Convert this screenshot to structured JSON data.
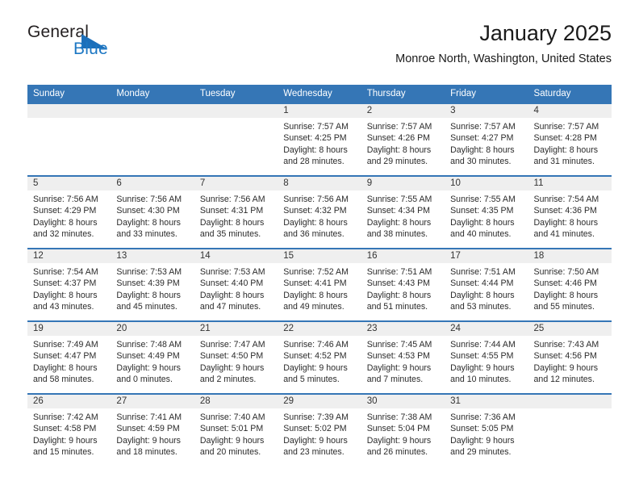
{
  "brand": {
    "name_top": "General",
    "name_bottom": "Blue",
    "triangle_icon": "triangle-icon",
    "accent_color": "#1c6fba"
  },
  "header": {
    "title": "January 2025",
    "subtitle": "Monroe North, Washington, United States"
  },
  "theme": {
    "header_blue": "#3576b6",
    "daynum_gray": "#efefef",
    "text": "#222222"
  },
  "weekday_headers": [
    "Sunday",
    "Monday",
    "Tuesday",
    "Wednesday",
    "Thursday",
    "Friday",
    "Saturday"
  ],
  "weeks": [
    [
      {
        "day": "",
        "sunrise": "",
        "sunset": "",
        "daylight_1": "",
        "daylight_2": ""
      },
      {
        "day": "",
        "sunrise": "",
        "sunset": "",
        "daylight_1": "",
        "daylight_2": ""
      },
      {
        "day": "",
        "sunrise": "",
        "sunset": "",
        "daylight_1": "",
        "daylight_2": ""
      },
      {
        "day": "1",
        "sunrise": "Sunrise: 7:57 AM",
        "sunset": "Sunset: 4:25 PM",
        "daylight_1": "Daylight: 8 hours",
        "daylight_2": "and 28 minutes."
      },
      {
        "day": "2",
        "sunrise": "Sunrise: 7:57 AM",
        "sunset": "Sunset: 4:26 PM",
        "daylight_1": "Daylight: 8 hours",
        "daylight_2": "and 29 minutes."
      },
      {
        "day": "3",
        "sunrise": "Sunrise: 7:57 AM",
        "sunset": "Sunset: 4:27 PM",
        "daylight_1": "Daylight: 8 hours",
        "daylight_2": "and 30 minutes."
      },
      {
        "day": "4",
        "sunrise": "Sunrise: 7:57 AM",
        "sunset": "Sunset: 4:28 PM",
        "daylight_1": "Daylight: 8 hours",
        "daylight_2": "and 31 minutes."
      }
    ],
    [
      {
        "day": "5",
        "sunrise": "Sunrise: 7:56 AM",
        "sunset": "Sunset: 4:29 PM",
        "daylight_1": "Daylight: 8 hours",
        "daylight_2": "and 32 minutes."
      },
      {
        "day": "6",
        "sunrise": "Sunrise: 7:56 AM",
        "sunset": "Sunset: 4:30 PM",
        "daylight_1": "Daylight: 8 hours",
        "daylight_2": "and 33 minutes."
      },
      {
        "day": "7",
        "sunrise": "Sunrise: 7:56 AM",
        "sunset": "Sunset: 4:31 PM",
        "daylight_1": "Daylight: 8 hours",
        "daylight_2": "and 35 minutes."
      },
      {
        "day": "8",
        "sunrise": "Sunrise: 7:56 AM",
        "sunset": "Sunset: 4:32 PM",
        "daylight_1": "Daylight: 8 hours",
        "daylight_2": "and 36 minutes."
      },
      {
        "day": "9",
        "sunrise": "Sunrise: 7:55 AM",
        "sunset": "Sunset: 4:34 PM",
        "daylight_1": "Daylight: 8 hours",
        "daylight_2": "and 38 minutes."
      },
      {
        "day": "10",
        "sunrise": "Sunrise: 7:55 AM",
        "sunset": "Sunset: 4:35 PM",
        "daylight_1": "Daylight: 8 hours",
        "daylight_2": "and 40 minutes."
      },
      {
        "day": "11",
        "sunrise": "Sunrise: 7:54 AM",
        "sunset": "Sunset: 4:36 PM",
        "daylight_1": "Daylight: 8 hours",
        "daylight_2": "and 41 minutes."
      }
    ],
    [
      {
        "day": "12",
        "sunrise": "Sunrise: 7:54 AM",
        "sunset": "Sunset: 4:37 PM",
        "daylight_1": "Daylight: 8 hours",
        "daylight_2": "and 43 minutes."
      },
      {
        "day": "13",
        "sunrise": "Sunrise: 7:53 AM",
        "sunset": "Sunset: 4:39 PM",
        "daylight_1": "Daylight: 8 hours",
        "daylight_2": "and 45 minutes."
      },
      {
        "day": "14",
        "sunrise": "Sunrise: 7:53 AM",
        "sunset": "Sunset: 4:40 PM",
        "daylight_1": "Daylight: 8 hours",
        "daylight_2": "and 47 minutes."
      },
      {
        "day": "15",
        "sunrise": "Sunrise: 7:52 AM",
        "sunset": "Sunset: 4:41 PM",
        "daylight_1": "Daylight: 8 hours",
        "daylight_2": "and 49 minutes."
      },
      {
        "day": "16",
        "sunrise": "Sunrise: 7:51 AM",
        "sunset": "Sunset: 4:43 PM",
        "daylight_1": "Daylight: 8 hours",
        "daylight_2": "and 51 minutes."
      },
      {
        "day": "17",
        "sunrise": "Sunrise: 7:51 AM",
        "sunset": "Sunset: 4:44 PM",
        "daylight_1": "Daylight: 8 hours",
        "daylight_2": "and 53 minutes."
      },
      {
        "day": "18",
        "sunrise": "Sunrise: 7:50 AM",
        "sunset": "Sunset: 4:46 PM",
        "daylight_1": "Daylight: 8 hours",
        "daylight_2": "and 55 minutes."
      }
    ],
    [
      {
        "day": "19",
        "sunrise": "Sunrise: 7:49 AM",
        "sunset": "Sunset: 4:47 PM",
        "daylight_1": "Daylight: 8 hours",
        "daylight_2": "and 58 minutes."
      },
      {
        "day": "20",
        "sunrise": "Sunrise: 7:48 AM",
        "sunset": "Sunset: 4:49 PM",
        "daylight_1": "Daylight: 9 hours",
        "daylight_2": "and 0 minutes."
      },
      {
        "day": "21",
        "sunrise": "Sunrise: 7:47 AM",
        "sunset": "Sunset: 4:50 PM",
        "daylight_1": "Daylight: 9 hours",
        "daylight_2": "and 2 minutes."
      },
      {
        "day": "22",
        "sunrise": "Sunrise: 7:46 AM",
        "sunset": "Sunset: 4:52 PM",
        "daylight_1": "Daylight: 9 hours",
        "daylight_2": "and 5 minutes."
      },
      {
        "day": "23",
        "sunrise": "Sunrise: 7:45 AM",
        "sunset": "Sunset: 4:53 PM",
        "daylight_1": "Daylight: 9 hours",
        "daylight_2": "and 7 minutes."
      },
      {
        "day": "24",
        "sunrise": "Sunrise: 7:44 AM",
        "sunset": "Sunset: 4:55 PM",
        "daylight_1": "Daylight: 9 hours",
        "daylight_2": "and 10 minutes."
      },
      {
        "day": "25",
        "sunrise": "Sunrise: 7:43 AM",
        "sunset": "Sunset: 4:56 PM",
        "daylight_1": "Daylight: 9 hours",
        "daylight_2": "and 12 minutes."
      }
    ],
    [
      {
        "day": "26",
        "sunrise": "Sunrise: 7:42 AM",
        "sunset": "Sunset: 4:58 PM",
        "daylight_1": "Daylight: 9 hours",
        "daylight_2": "and 15 minutes."
      },
      {
        "day": "27",
        "sunrise": "Sunrise: 7:41 AM",
        "sunset": "Sunset: 4:59 PM",
        "daylight_1": "Daylight: 9 hours",
        "daylight_2": "and 18 minutes."
      },
      {
        "day": "28",
        "sunrise": "Sunrise: 7:40 AM",
        "sunset": "Sunset: 5:01 PM",
        "daylight_1": "Daylight: 9 hours",
        "daylight_2": "and 20 minutes."
      },
      {
        "day": "29",
        "sunrise": "Sunrise: 7:39 AM",
        "sunset": "Sunset: 5:02 PM",
        "daylight_1": "Daylight: 9 hours",
        "daylight_2": "and 23 minutes."
      },
      {
        "day": "30",
        "sunrise": "Sunrise: 7:38 AM",
        "sunset": "Sunset: 5:04 PM",
        "daylight_1": "Daylight: 9 hours",
        "daylight_2": "and 26 minutes."
      },
      {
        "day": "31",
        "sunrise": "Sunrise: 7:36 AM",
        "sunset": "Sunset: 5:05 PM",
        "daylight_1": "Daylight: 9 hours",
        "daylight_2": "and 29 minutes."
      },
      {
        "day": "",
        "sunrise": "",
        "sunset": "",
        "daylight_1": "",
        "daylight_2": ""
      }
    ]
  ]
}
